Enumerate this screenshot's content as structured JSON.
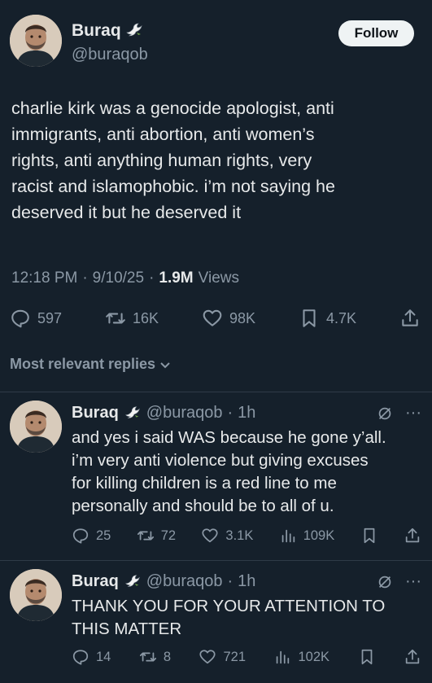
{
  "main_tweet": {
    "author_name": "Buraq",
    "handle": "@buraqob",
    "follow_label": "Follow",
    "text": "charlie kirk was a genocide apologist, anti\nimmigrants, anti abortion, anti women’s\nrights, anti anything human rights, very\nracist and islamophobic. i’m not saying he\ndeserved it but he deserved it",
    "time": "12:18 PM",
    "date": "9/10/25",
    "views_count": "1.9M",
    "views_label": "Views",
    "replies": "597",
    "reposts": "16K",
    "likes": "98K",
    "bookmarks": "4.7K"
  },
  "replies_header": {
    "sort_label": "Most relevant replies"
  },
  "replies": [
    {
      "author_name": "Buraq",
      "handle": "@buraqob",
      "age": "1h",
      "text": "and yes i said WAS because he gone y’all.\ni’m very anti violence but giving excuses\nfor killing children is a red line to me\npersonally and should be to all of u.",
      "replies": "25",
      "reposts": "72",
      "likes": "3.1K",
      "views": "109K"
    },
    {
      "author_name": "Buraq",
      "handle": "@buraqob",
      "age": "1h",
      "text": "THANK YOU FOR YOUR ATTENTION TO\nTHIS MATTER",
      "replies": "14",
      "reposts": "8",
      "likes": "721",
      "views": "102K"
    }
  ],
  "icons": {
    "emoji": "dove-emoji",
    "reply": "reply-icon",
    "repost": "repost-icon",
    "like": "heart-icon",
    "views": "views-chart-icon",
    "bookmark": "bookmark-icon",
    "share": "share-icon",
    "grok": "grok-icon",
    "more": "more-icon"
  },
  "colors": {
    "background": "#15202b",
    "text": "#e7e9ea",
    "muted": "#8b98a5",
    "follow_bg": "#eff3f4"
  }
}
